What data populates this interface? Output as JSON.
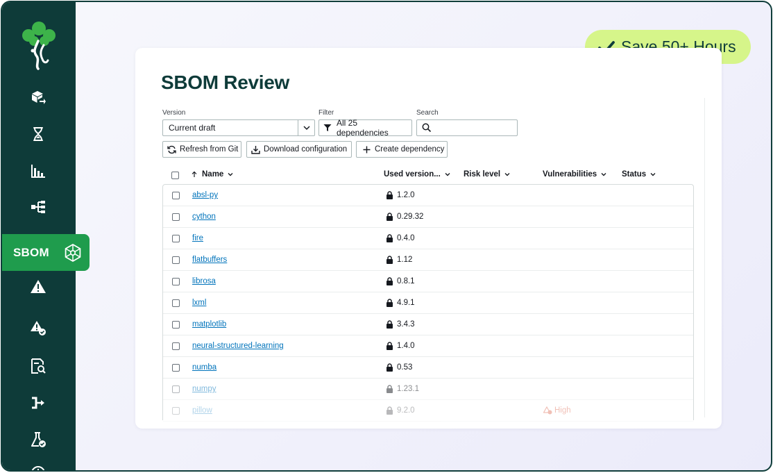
{
  "badge": {
    "text": "Save 50+ Hours"
  },
  "sidebar": {
    "active_tab_label": "SBOM",
    "items": [
      {
        "icon": "package-arrow-icon"
      },
      {
        "icon": "hourglass-icon"
      },
      {
        "icon": "bar-chart-icon"
      },
      {
        "icon": "tree-structure-icon"
      },
      {
        "icon": "sbom-network-icon"
      },
      {
        "icon": "warning-icon"
      },
      {
        "icon": "warning-check-icon"
      },
      {
        "icon": "document-search-icon"
      },
      {
        "icon": "arrow-flow-icon"
      },
      {
        "icon": "flask-check-icon"
      },
      {
        "icon": "clock-icon"
      }
    ]
  },
  "page": {
    "title": "SBOM Review"
  },
  "controls": {
    "version_label": "Version",
    "version_value": "Current draft",
    "filter_label": "Filter",
    "filter_value": "All 25 dependencies",
    "search_label": "Search",
    "search_value": "",
    "refresh_label": "Refresh from Git",
    "download_label": "Download configuration",
    "create_label": "Create dependency"
  },
  "table": {
    "columns": {
      "name": "Name",
      "version": "Used version...",
      "risk": "Risk level",
      "vulnerabilities": "Vulnerabilities",
      "status": "Status"
    },
    "rows": [
      {
        "name": "absl-py",
        "version": "1.2.0",
        "vulnerabilities": ""
      },
      {
        "name": "cython",
        "version": "0.29.32",
        "vulnerabilities": ""
      },
      {
        "name": "fire",
        "version": "0.4.0",
        "vulnerabilities": ""
      },
      {
        "name": "flatbuffers",
        "version": "1.12",
        "vulnerabilities": ""
      },
      {
        "name": "librosa",
        "version": "0.8.1",
        "vulnerabilities": ""
      },
      {
        "name": "lxml",
        "version": "4.9.1",
        "vulnerabilities": ""
      },
      {
        "name": "matplotlib",
        "version": "3.4.3",
        "vulnerabilities": ""
      },
      {
        "name": "neural-structured-learning",
        "version": "1.4.0",
        "vulnerabilities": ""
      },
      {
        "name": "numba",
        "version": "0.53",
        "vulnerabilities": ""
      },
      {
        "name": "numpy",
        "version": "1.23.1",
        "vulnerabilities": ""
      },
      {
        "name": "pillow",
        "version": "9.2.0",
        "vulnerabilities": "High"
      }
    ]
  },
  "colors": {
    "sidebar": "#0e3b39",
    "active_tab": "#1f9c4d",
    "badge": "#d6f58a",
    "link": "#0073bb",
    "danger": "#d13212"
  }
}
